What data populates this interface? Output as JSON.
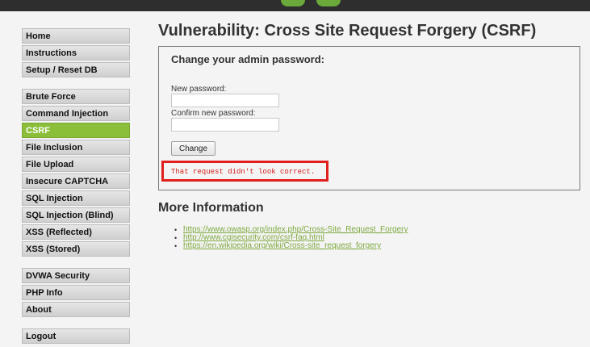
{
  "page": {
    "title": "Vulnerability: Cross Site Request Forgery (CSRF)"
  },
  "menu": {
    "groups": [
      [
        {
          "label": "Home",
          "selected": false
        },
        {
          "label": "Instructions",
          "selected": false
        },
        {
          "label": "Setup / Reset DB",
          "selected": false
        }
      ],
      [
        {
          "label": "Brute Force",
          "selected": false
        },
        {
          "label": "Command Injection",
          "selected": false
        },
        {
          "label": "CSRF",
          "selected": true
        },
        {
          "label": "File Inclusion",
          "selected": false
        },
        {
          "label": "File Upload",
          "selected": false
        },
        {
          "label": "Insecure CAPTCHA",
          "selected": false
        },
        {
          "label": "SQL Injection",
          "selected": false
        },
        {
          "label": "SQL Injection (Blind)",
          "selected": false
        },
        {
          "label": "XSS (Reflected)",
          "selected": false
        },
        {
          "label": "XSS (Stored)",
          "selected": false
        }
      ],
      [
        {
          "label": "DVWA Security",
          "selected": false
        },
        {
          "label": "PHP Info",
          "selected": false
        },
        {
          "label": "About",
          "selected": false
        }
      ],
      [
        {
          "label": "Logout",
          "selected": false
        }
      ]
    ],
    "selected_color": "#8bbf3a"
  },
  "form": {
    "title": "Change your admin password:",
    "new_password_label": "New password:",
    "new_password_value": "",
    "confirm_password_label": "Confirm new password:",
    "confirm_password_value": "",
    "button_label": "Change",
    "error_message": "That request didn't look correct.",
    "error_color": "#e0201c"
  },
  "more_info": {
    "title": "More Information",
    "links": [
      "https://www.owasp.org/index.php/Cross-Site_Request_Forgery",
      "http://www.cgisecurity.com/csrf-faq.html",
      "https://en.wikipedia.org/wiki/Cross-site_request_forgery"
    ],
    "link_color": "#7ea93f"
  }
}
